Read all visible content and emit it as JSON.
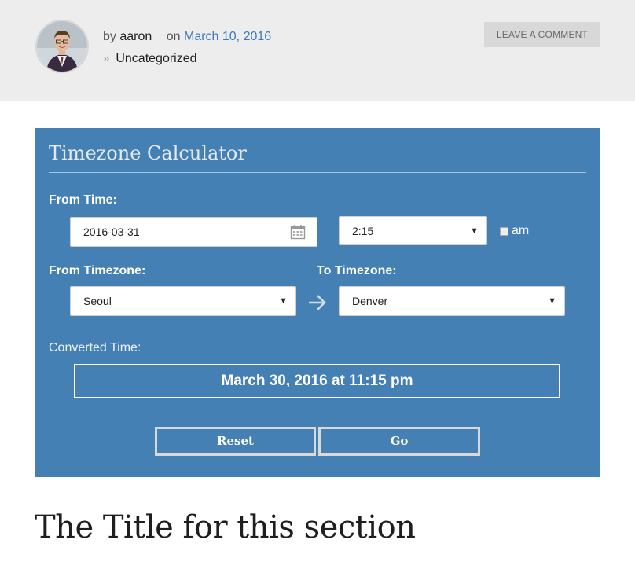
{
  "post_meta": {
    "by_prefix": "by",
    "author": "aaron",
    "on_prefix": "on",
    "date": "March 10, 2016",
    "category": "Uncategorized",
    "comment_button": "LEAVE A COMMENT"
  },
  "calculator": {
    "title": "Timezone Calculator",
    "from_time_label": "From Time:",
    "date_value": "2016-03-31",
    "time_value": "2:15",
    "am_label": "am",
    "am_checked": false,
    "from_timezone_label": "From Timezone:",
    "from_timezone_value": "Seoul",
    "to_timezone_label": "To Timezone:",
    "to_timezone_value": "Denver",
    "converted_label": "Converted Time:",
    "converted_value": "March 30, 2016 at 11:15 pm",
    "reset_label": "Reset",
    "go_label": "Go"
  },
  "section": {
    "title": "The Title for this section"
  },
  "icons": {
    "category": "chevron-double-right-icon",
    "date_picker": "calendar-icon",
    "dropdown": "caret-down-icon",
    "direction": "arrow-right-icon"
  },
  "colors": {
    "calculator_bg": "#4580b4",
    "meta_bg": "#ededed",
    "link": "#3d7ab8",
    "button_border": "#d9d9d9"
  }
}
